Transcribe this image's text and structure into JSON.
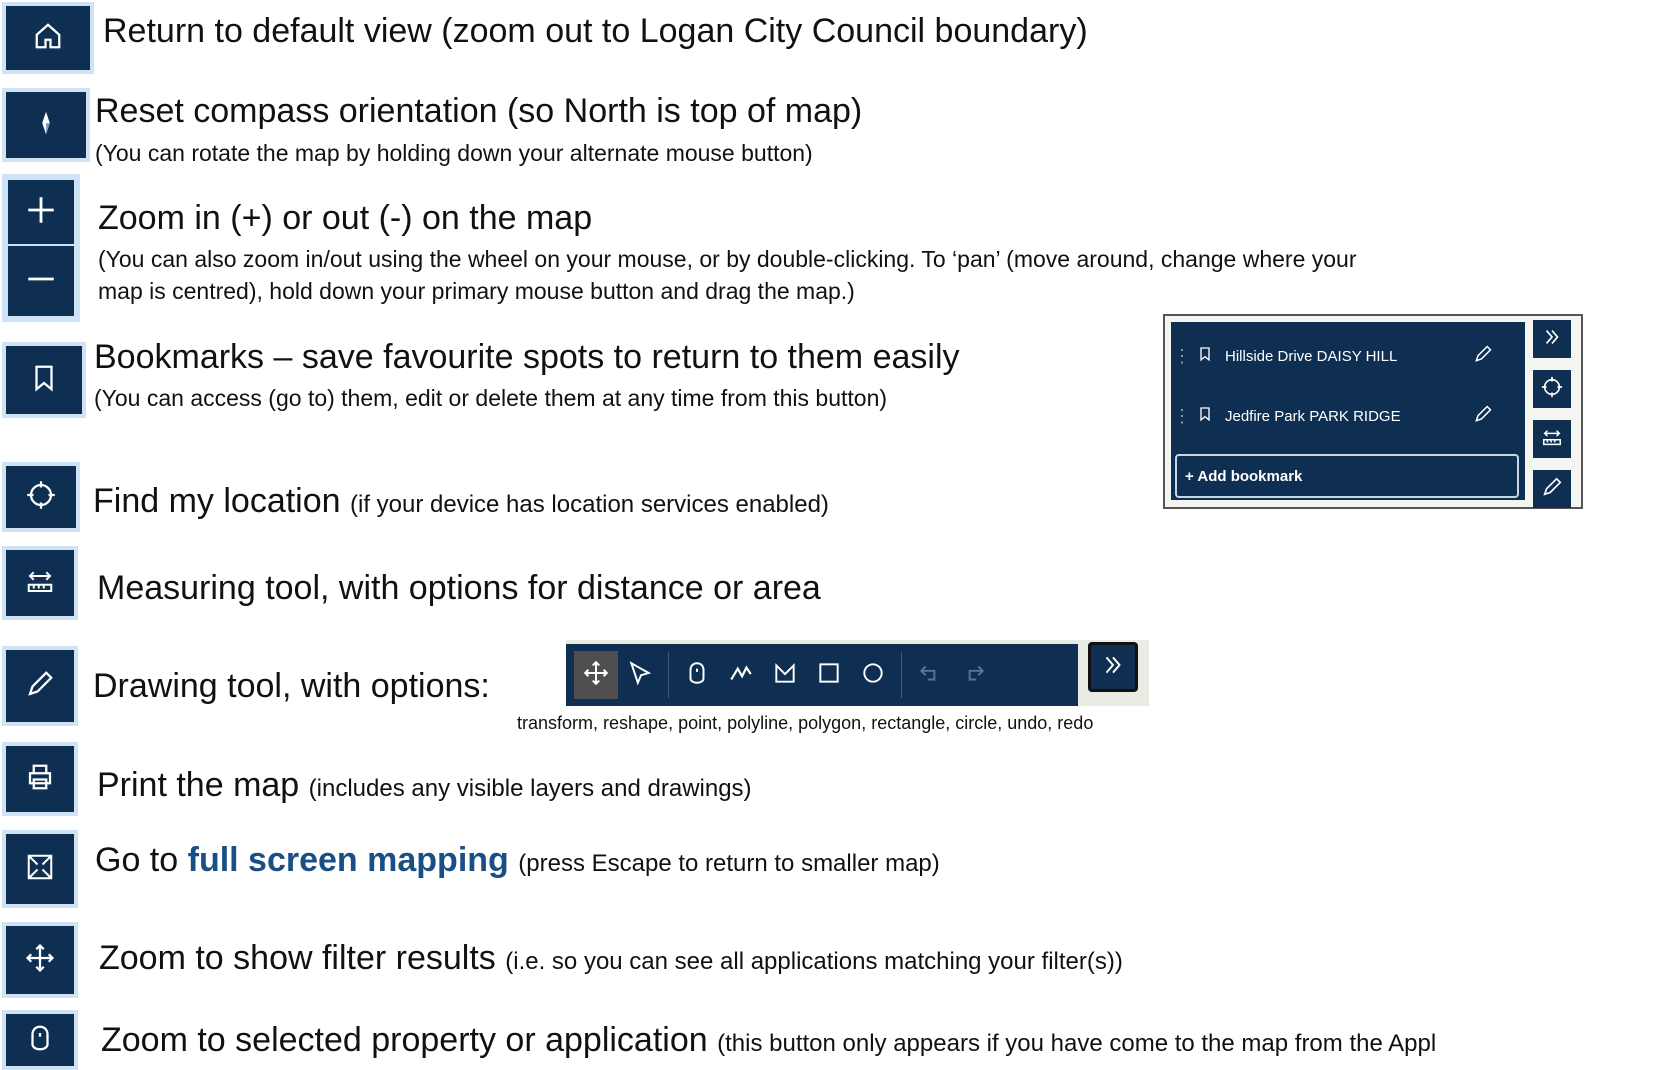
{
  "rows": {
    "home": {
      "title": "Return to default view (zoom out to Logan City Council boundary)",
      "icon": "home-icon"
    },
    "compass": {
      "title": "Reset compass orientation (so North is top of map)",
      "sub": "(You can rotate the map by holding down your alternate mouse button)",
      "icon": "compass-icon"
    },
    "zoom": {
      "title": "Zoom in (+) or out (-) on the map",
      "sub1": "(You can also zoom in/out using the wheel on your mouse, or by double-clicking.  To ‘pan’ (move around, change where your",
      "sub2": "map is centred), hold down your primary mouse button and drag the map.)",
      "icons": [
        "zoom-in-icon",
        "zoom-out-icon"
      ]
    },
    "bookmarks": {
      "title": "Bookmarks – save favourite spots to return to them easily",
      "sub": "(You can access (go to) them, edit or delete them at any time from this button)",
      "icon": "bookmark-icon"
    },
    "locate": {
      "title": "Find my location",
      "note": "(if your device has location services enabled)",
      "icon": "locate-icon"
    },
    "measure": {
      "title": "Measuring tool, with options for distance or area",
      "icon": "measure-icon"
    },
    "draw": {
      "title": "Drawing tool, with options:",
      "icon": "pencil-icon",
      "caption": "transform, reshape, point, polyline, polygon, rectangle, circle, undo, redo"
    },
    "print": {
      "title": "Print the map",
      "note": "(includes any visible layers and drawings)",
      "icon": "print-icon"
    },
    "fullscreen": {
      "pre": "Go to",
      "accent": "full screen mapping",
      "note": "(press Escape to return to smaller map)",
      "icon": "fullscreen-icon"
    },
    "filter": {
      "title": "Zoom to show filter results",
      "note": "(i.e. so you can see all applications matching your filter(s))",
      "icon": "move-icon"
    },
    "selected": {
      "title": "Zoom to selected property or application",
      "note": "(this button only appears if you have come to the map from the Appl",
      "icon": "point-icon"
    }
  },
  "bookmark_panel": {
    "items": [
      "Hillside Drive DAISY HILL",
      "Jedfire Park PARK RIDGE"
    ],
    "add_label": "+ Add bookmark"
  },
  "colors": {
    "toolbar_bg": "#0e2f52",
    "icon_border": "#cfe3f5",
    "accent_text": "#1a4f86"
  }
}
